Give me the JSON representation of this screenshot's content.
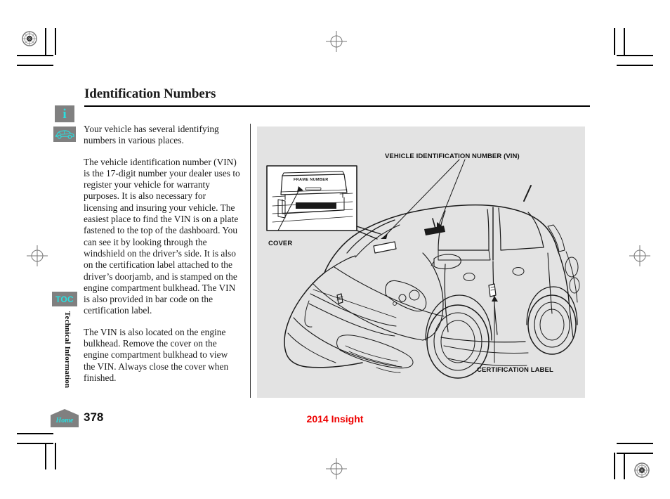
{
  "page": {
    "title": "Identification Numbers",
    "number": "378",
    "model_footer": "2014 Insight",
    "section_label": "Technical Information"
  },
  "nav": {
    "toc_label": "TOC",
    "home_label": "Home",
    "info_icon": "i"
  },
  "body": {
    "paragraphs": [
      "Your vehicle has several identifying numbers in various places.",
      "The vehicle identification number (VIN) is the 17-digit number your dealer uses to register your vehicle for warranty purposes. It is also necessary for licensing and insuring your vehicle. The easiest place to find the VIN is on a plate fastened to the top of the dashboard. You can see it by looking through the windshield on the driver’s side. It is also on the certification label attached to the driver’s doorjamb, and is stamped on the engine compartment bulkhead. The VIN is also provided in bar code on the certification label.",
      "The VIN is also located on the engine bulkhead. Remove the cover on the engine compartment bulkhead to view the VIN. Always close the cover when finished."
    ]
  },
  "diagram": {
    "labels": {
      "vin": "VEHICLE IDENTIFICATION NUMBER (VIN)",
      "cover": "COVER",
      "certification": "CERTIFICATION LABEL",
      "inset_plate": "FRAME   NUMBER"
    }
  },
  "colors": {
    "accent_cyan": "#28e0e0",
    "badge_gray": "#808080",
    "panel_gray": "#e3e3e3",
    "footer_red": "#ee0000",
    "ink": "#1a1a1a"
  }
}
